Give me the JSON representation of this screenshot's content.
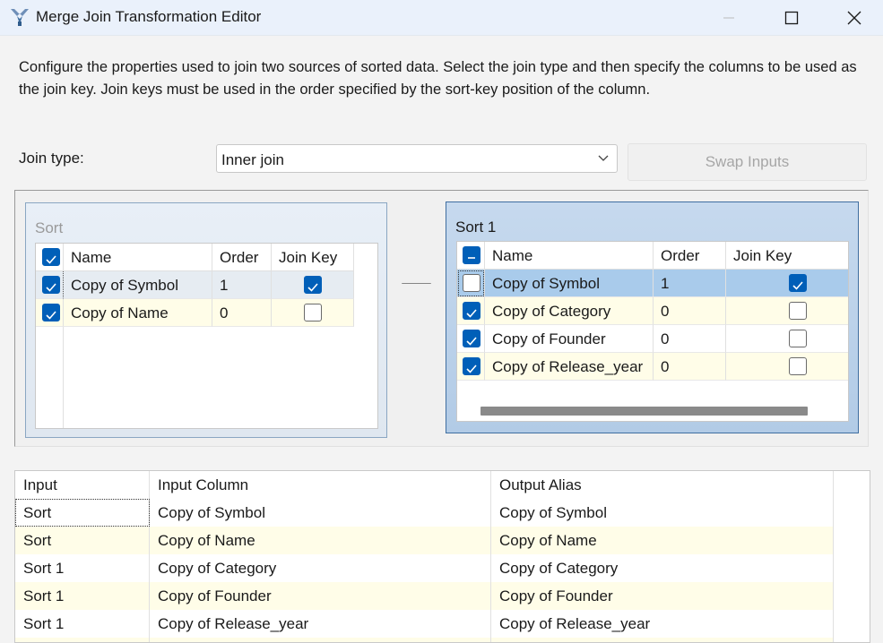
{
  "window": {
    "title": "Merge Join Transformation Editor",
    "icon": "merge-join-app-icon",
    "controls": [
      "minimize-icon",
      "maximize-icon",
      "close-icon"
    ]
  },
  "description": "Configure the properties used to join two sources of sorted data. Select the join type and then specify the columns to be used as the join key. Join keys must be used in the order specified by the sort-key position of the column.",
  "join": {
    "label": "Join type:",
    "value": "Inner join",
    "swap_label": "Swap Inputs"
  },
  "left_input": {
    "title": "Sort",
    "headers": [
      "Name",
      "Order",
      "Join Key"
    ],
    "rows": [
      {
        "checked": true,
        "name": "Copy of Symbol",
        "order": "1",
        "join_key": true
      },
      {
        "checked": true,
        "name": "Copy of Name",
        "order": "0",
        "join_key": false
      }
    ]
  },
  "right_input": {
    "title": "Sort 1",
    "headers": [
      "Name",
      "Order",
      "Join Key"
    ],
    "rows": [
      {
        "checked": false,
        "name": "Copy of Symbol",
        "order": "1",
        "join_key": true
      },
      {
        "checked": true,
        "name": "Copy of Category",
        "order": "0",
        "join_key": false
      },
      {
        "checked": true,
        "name": "Copy of Founder",
        "order": "0",
        "join_key": false
      },
      {
        "checked": true,
        "name": "Copy of Release_year",
        "order": "0",
        "join_key": false
      }
    ]
  },
  "output": {
    "headers": [
      "Input",
      "Input Column",
      "Output Alias"
    ],
    "rows": [
      {
        "input": "Sort",
        "column": "Copy of Symbol",
        "alias": "Copy of Symbol"
      },
      {
        "input": "Sort",
        "column": "Copy of Name",
        "alias": "Copy of Name"
      },
      {
        "input": "Sort 1",
        "column": "Copy of Category",
        "alias": "Copy of Category"
      },
      {
        "input": "Sort 1",
        "column": "Copy of Founder",
        "alias": "Copy of Founder"
      },
      {
        "input": "Sort 1",
        "column": "Copy of Release_year",
        "alias": "Copy of Release_year"
      }
    ]
  },
  "colors": {
    "accent": "#005fb8",
    "row_alt": "#fffde8",
    "row_selected": "#a9cbeb",
    "row_hover": "#e6ecf2"
  }
}
